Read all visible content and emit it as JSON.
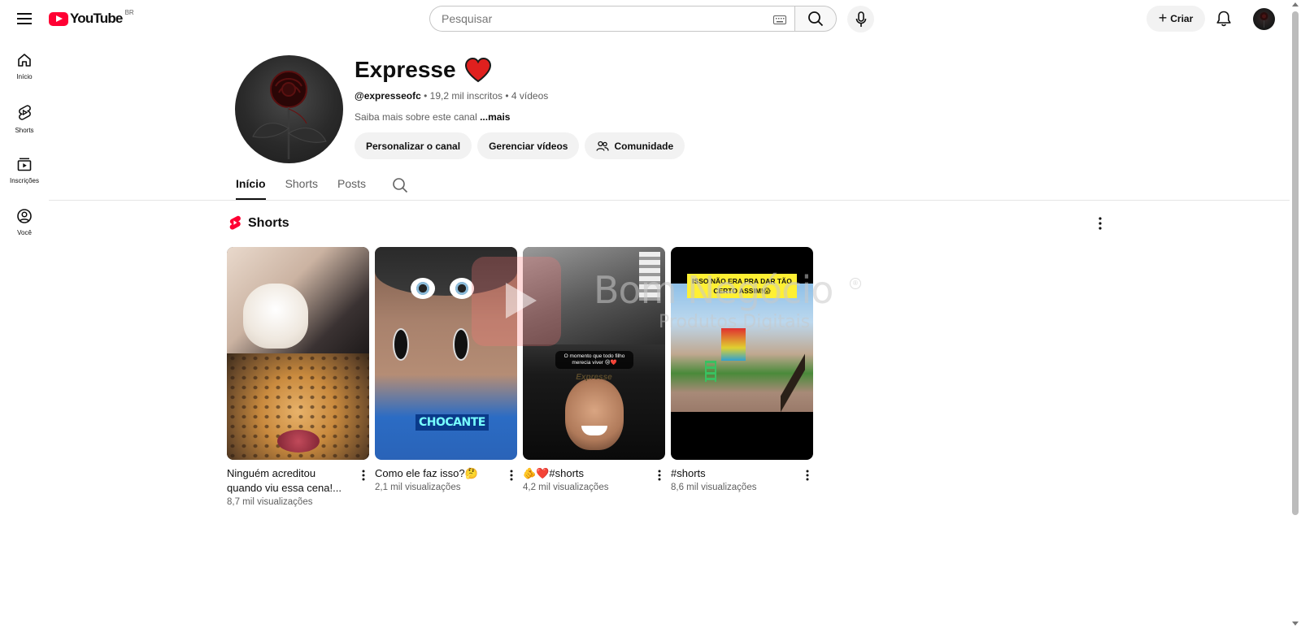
{
  "header": {
    "logo_text": "YouTube",
    "region": "BR",
    "search_placeholder": "Pesquisar",
    "create_label": "Criar"
  },
  "sidebar": {
    "items": [
      {
        "label": "Início",
        "icon": "home-icon"
      },
      {
        "label": "Shorts",
        "icon": "shorts-icon"
      },
      {
        "label": "Inscrições",
        "icon": "subscriptions-icon"
      },
      {
        "label": "Você",
        "icon": "user-circle-icon"
      }
    ]
  },
  "channel": {
    "name": "Expresse",
    "name_emoji": "heart-icon",
    "handle": "@expresseofc",
    "subscribers": "19,2 mil inscritos",
    "videos": "4 vídeos",
    "separator": "•",
    "description": "Saiba mais sobre este canal",
    "more_label": "...mais",
    "actions": {
      "customize": "Personalizar o canal",
      "manage": "Gerenciar vídeos",
      "community": "Comunidade"
    }
  },
  "tabs": {
    "home": "Início",
    "shorts": "Shorts",
    "posts": "Posts",
    "active": "Início"
  },
  "shorts_section": {
    "title": "Shorts",
    "items": [
      {
        "title": "Ninguém acreditou quando viu essa cena!...",
        "views": "8,7 mil visualizações"
      },
      {
        "title": "Como ele faz isso?🤔",
        "views": "2,1 mil visualizações",
        "thumb_label": "CHOCANTE"
      },
      {
        "title": "🫵❤️#shorts",
        "views": "4,2 mil visualizações",
        "thumb_caption": "O momento que todo filho merecia viver 😢❤️",
        "thumb_brand": "Expresse"
      },
      {
        "title": "#shorts",
        "views": "8,6 mil visualizações",
        "thumb_banner": "ISSO NÃO ERA PRA DAR TÃO CERTO ASSIM!😱"
      }
    ]
  },
  "watermark": {
    "line1": "Bom Negócio",
    "line2": "Produtos Digitais",
    "mark": "®"
  },
  "colors": {
    "brand_red": "#ff0033",
    "text_primary": "#0f0f0f",
    "text_secondary": "#606060",
    "chip_bg": "#f2f2f2"
  }
}
